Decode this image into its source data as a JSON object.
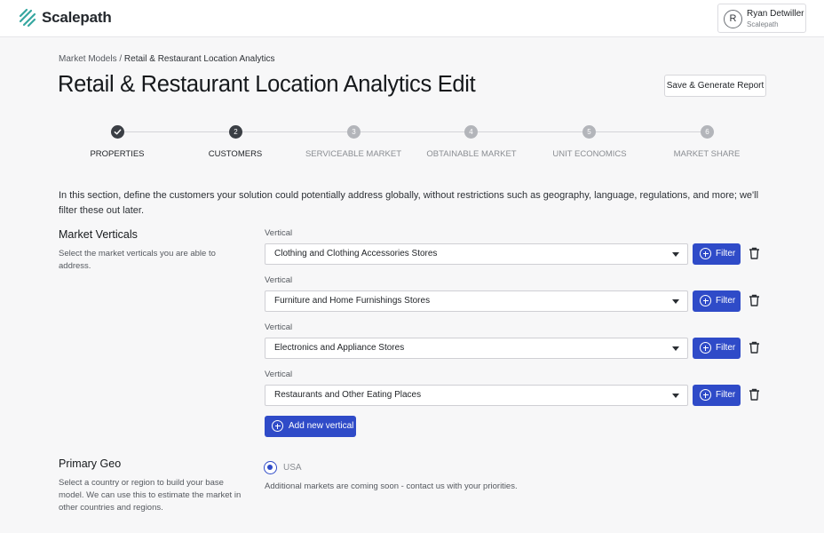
{
  "app": {
    "logo_text": "Scalepath"
  },
  "user": {
    "initial": "R",
    "name": "Ryan Detwiller",
    "org": "Scalepath"
  },
  "breadcrumb": {
    "parent": "Market Models",
    "separator": " / ",
    "current": "Retail & Restaurant Location Analytics"
  },
  "page": {
    "title": "Retail & Restaurant Location Analytics Edit",
    "save_button": "Save & Generate Report"
  },
  "steps": [
    {
      "number": "",
      "label": "PROPERTIES",
      "state": "completed"
    },
    {
      "number": "2",
      "label": "CUSTOMERS",
      "state": "current"
    },
    {
      "number": "3",
      "label": "SERVICEABLE MARKET",
      "state": "upcoming"
    },
    {
      "number": "4",
      "label": "OBTAINABLE MARKET",
      "state": "upcoming"
    },
    {
      "number": "5",
      "label": "UNIT ECONOMICS",
      "state": "upcoming"
    },
    {
      "number": "6",
      "label": "MARKET SHARE",
      "state": "upcoming"
    }
  ],
  "intro": "In this section, define the customers your solution could potentially address globally, without restrictions such as geography, language, regulations, and more; we'll filter these out later.",
  "market_verticals": {
    "title": "Market Verticals",
    "description": "Select the market verticals you are able to address.",
    "field_label": "Vertical",
    "filter_label": "Filter",
    "items": [
      "Clothing and Clothing Accessories Stores",
      "Furniture and Home Furnishings Stores",
      "Electronics and Appliance Stores",
      "Restaurants and Other Eating Places"
    ],
    "add_button": "Add new vertical"
  },
  "primary_geo": {
    "title": "Primary Geo",
    "description": "Select a country or region to build your base model. We can use this to estimate the market in other countries and regions.",
    "option": "USA",
    "note": "Additional markets are coming soon - contact us with your priorities."
  },
  "colors": {
    "accent": "#2f4bc8",
    "logo": "#36a7a0",
    "step_active": "#3b3f45",
    "step_inactive": "#b3b5ba"
  },
  "icons": {
    "logo": "scalepath-logo-icon",
    "step_done": "check-icon",
    "filter": "plus-circle-icon",
    "delete": "trash-icon",
    "dropdown": "chevron-down-icon"
  }
}
